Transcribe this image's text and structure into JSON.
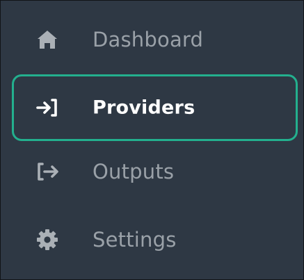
{
  "nav": {
    "items": [
      {
        "label": "Dashboard",
        "icon": "home-icon",
        "active": false
      },
      {
        "label": "Providers",
        "icon": "sign-in-arrow-icon",
        "active": true
      },
      {
        "label": "Outputs",
        "icon": "sign-out-arrow-icon",
        "active": false
      },
      {
        "label": "Settings",
        "icon": "gear-icon",
        "active": false
      }
    ]
  },
  "colors": {
    "background": "#2e3844",
    "active_border": "#23b08e",
    "active_text": "#ffffff",
    "inactive_text": "#9aa1a8"
  }
}
